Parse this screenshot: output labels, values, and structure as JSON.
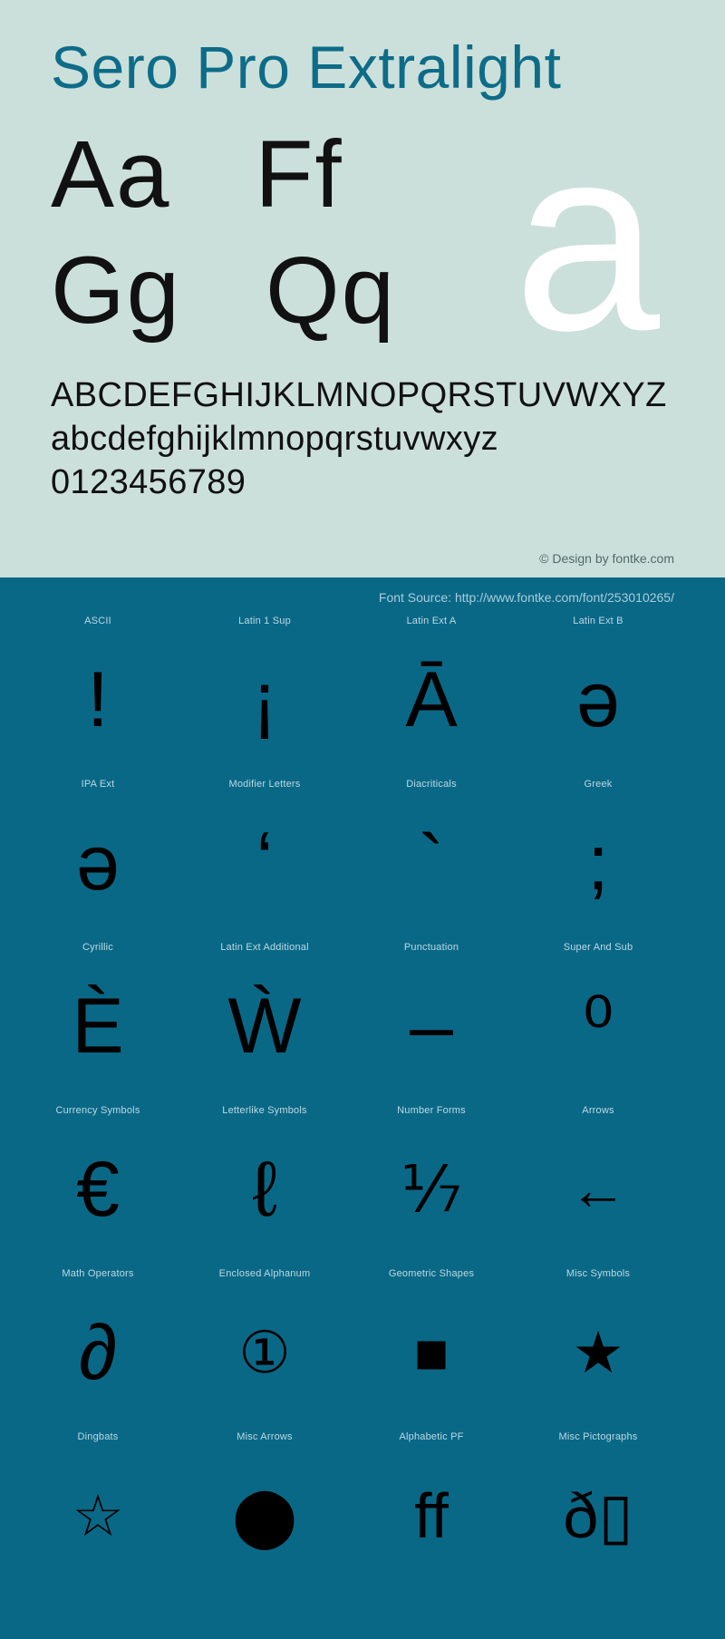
{
  "colors": {
    "light_bg": "#cce0db",
    "dark_bg": "#0a6887",
    "title": "#0d6c88",
    "glyph": "#111111",
    "highlight_glyph": "#ffffff",
    "label": "#bcd9e2"
  },
  "specimen": {
    "title": "Sero Pro Extralight",
    "sample_pairs_row1": [
      "Aa",
      "Ff"
    ],
    "sample_pairs_row2": [
      "Gg",
      "Qq"
    ],
    "big_letter": "a",
    "uppercase": "ABCDEFGHIJKLMNOPQRSTUVWXYZ",
    "lowercase": "abcdefghijklmnopqrstuvwxyz",
    "digits": "0123456789",
    "copyright": "© Design by fontke.com"
  },
  "source_bar": {
    "text": "Font Source: http://www.fontke.com/font/253010265/"
  },
  "glyph_map": {
    "rows": [
      [
        {
          "label": "ASCII",
          "glyph": "!",
          "icon": "exclamation-glyph"
        },
        {
          "label": "Latin 1 Sup",
          "glyph": "¡",
          "icon": "inverted-exclamation-glyph"
        },
        {
          "label": "Latin Ext A",
          "glyph": "Ā",
          "icon": "a-macron-glyph"
        },
        {
          "label": "Latin Ext B",
          "glyph": "ǝ",
          "icon": "turned-e-glyph"
        }
      ],
      [
        {
          "label": "IPA Ext",
          "glyph": "ə",
          "icon": "schwa-glyph"
        },
        {
          "label": "Modifier Letters",
          "glyph": "ʻ",
          "icon": "modifier-turned-comma-glyph"
        },
        {
          "label": "Diacriticals",
          "glyph": "`",
          "icon": "combining-grave-glyph"
        },
        {
          "label": "Greek",
          "glyph": ";",
          "icon": "greek-question-mark-glyph"
        }
      ],
      [
        {
          "label": "Cyrillic",
          "glyph": "È",
          "icon": "cyrillic-ie-grave-glyph"
        },
        {
          "label": "Latin Ext Additional",
          "glyph": "Ẁ",
          "icon": "w-grave-glyph"
        },
        {
          "label": "Punctuation",
          "glyph": "‒",
          "icon": "figure-dash-glyph"
        },
        {
          "label": "Super And Sub",
          "glyph": "⁰",
          "icon": "superscript-zero-glyph"
        }
      ],
      [
        {
          "label": "Currency Symbols",
          "glyph": "€",
          "icon": "euro-sign-glyph"
        },
        {
          "label": "Letterlike Symbols",
          "glyph": "ℓ",
          "icon": "script-small-l-glyph"
        },
        {
          "label": "Number Forms",
          "glyph": "⅐",
          "icon": "one-seventh-fraction-glyph"
        },
        {
          "label": "Arrows",
          "glyph": "←",
          "icon": "left-arrow-glyph"
        }
      ],
      [
        {
          "label": "Math Operators",
          "glyph": "∂",
          "icon": "partial-differential-glyph"
        },
        {
          "label": "Enclosed Alphanum",
          "glyph": "①",
          "icon": "circled-one-glyph"
        },
        {
          "label": "Geometric Shapes",
          "glyph": "■",
          "icon": "black-square-glyph"
        },
        {
          "label": "Misc Symbols",
          "glyph": "★",
          "icon": "black-star-glyph"
        }
      ],
      [
        {
          "label": "Dingbats",
          "glyph": "☆",
          "icon": "white-star-glyph"
        },
        {
          "label": "Misc Arrows",
          "glyph": "⬤",
          "icon": "black-circle-glyph"
        },
        {
          "label": "Alphabetic PF",
          "glyph": "ff",
          "icon": "ff-ligature-glyph"
        },
        {
          "label": "Misc Pictographs",
          "glyph": "ð▯",
          "icon": "eth-tofu-glyph"
        }
      ]
    ]
  }
}
